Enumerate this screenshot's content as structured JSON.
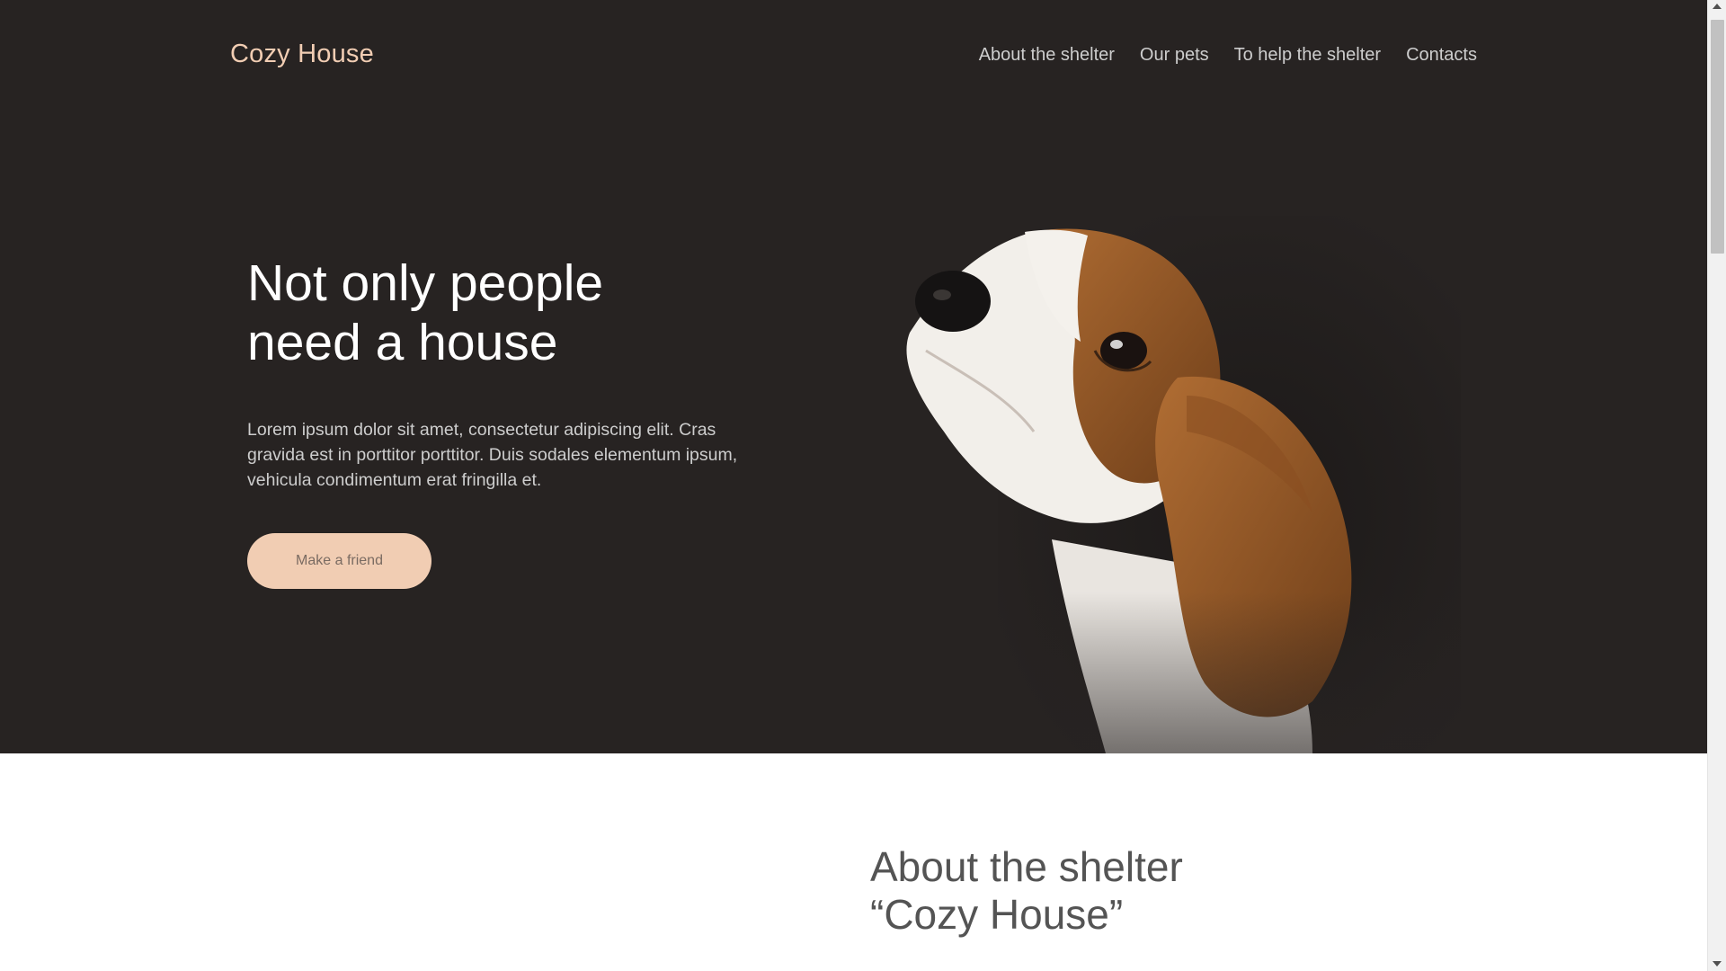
{
  "header": {
    "logo": "Cozy House",
    "nav": [
      {
        "label": "About the shelter"
      },
      {
        "label": "Our pets"
      },
      {
        "label": "To help the shelter"
      },
      {
        "label": "Contacts"
      }
    ]
  },
  "hero": {
    "title_line1": "Not only people",
    "title_line2": "need a house",
    "text": "Lorem ipsum dolor sit amet, consectetur adipiscing elit. Cras gravida est in porttitor porttitor. Duis sodales elementum ipsum, vehicula condimentum erat fringilla et.",
    "button_label": "Make a friend",
    "image_icon": "beagle-puppy-illustration"
  },
  "about": {
    "title_line1": "About the shelter",
    "title_line2": "“Cozy House”"
  },
  "colors": {
    "hero_background": "#272322",
    "accent": "#f1cdb3",
    "hero_text": "#cdcdcd",
    "heading_dark": "#545454"
  }
}
